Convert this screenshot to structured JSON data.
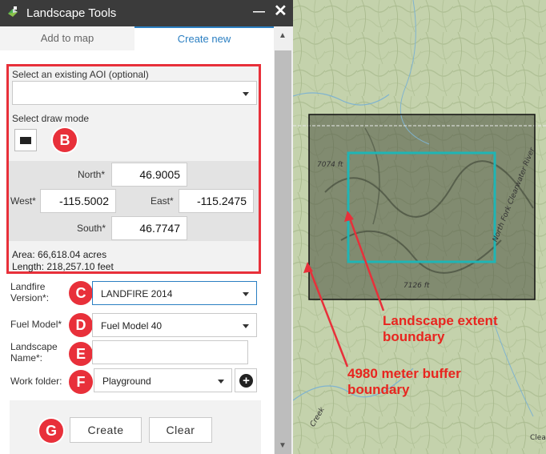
{
  "window": {
    "title": "Landscape Tools",
    "minimize": "—",
    "close": "✕"
  },
  "tabs": [
    {
      "label": "Add to map"
    },
    {
      "label": "Create new"
    }
  ],
  "aoi": {
    "select_label": "Select an existing AOI (optional)",
    "select_value": "",
    "draw_mode_label": "Select draw mode",
    "draw_mode_icon": "rectangle-icon"
  },
  "coords": {
    "north_label": "North*",
    "north": "46.9005",
    "west_label": "West*",
    "west": "-115.5002",
    "east_label": "East*",
    "east": "-115.2475",
    "south_label": "South*",
    "south": "46.7747"
  },
  "summary": {
    "area": "Area: 66,618.04 acres",
    "length": "Length: 218,257.10 feet"
  },
  "form": {
    "landfire_label_1": "Landfire",
    "landfire_label_2": "Version*:",
    "landfire_value": "LANDFIRE 2014",
    "fuel_label": "Fuel Model*",
    "fuel_value": "Fuel Model 40",
    "landscape_label_1": "Landscape",
    "landscape_label_2": "Name*:",
    "landscape_value": "",
    "folder_label": "Work folder:",
    "folder_value": "Playground",
    "add_folder_icon": "plus-circle-icon"
  },
  "buttons": {
    "create": "Create",
    "clear": "Clear"
  },
  "badges": {
    "b": "B",
    "c": "C",
    "d": "D",
    "e": "E",
    "f": "F",
    "g": "G"
  },
  "map": {
    "elev_label_1": "7074 ft",
    "elev_label_2": "7126 ft",
    "road_label": "North Fork Clearwater River",
    "creek_label": "Creek",
    "attribution": "Clea",
    "annotation_1_line1": "Landscape extent",
    "annotation_1_line2": "boundary",
    "annotation_2_line1": "4980 meter buffer",
    "annotation_2_line2": "boundary"
  },
  "colors": {
    "accent": "#2b7fc2",
    "highlight": "#e8303a",
    "extent": "#1fb5b5"
  }
}
